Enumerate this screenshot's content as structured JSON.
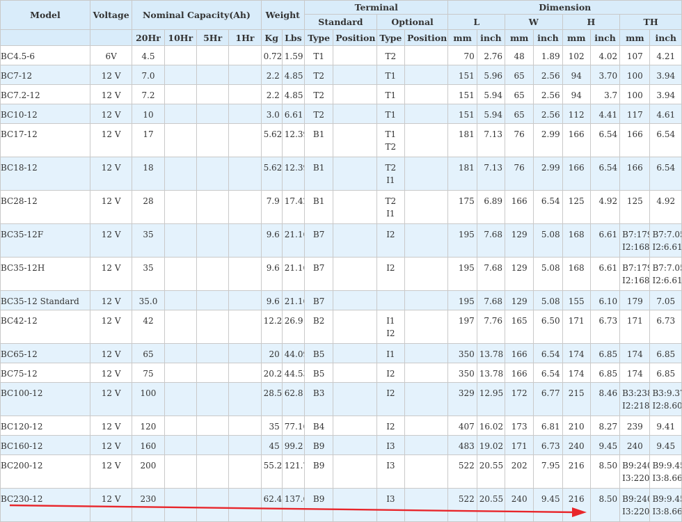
{
  "headers": {
    "model": "Model",
    "voltage": "Voltage",
    "nominal_capacity": "Nominal Capacity(Ah)",
    "weight": "Weight",
    "terminal": "Terminal",
    "dimension": "Dimension",
    "standard": "Standard",
    "optional": "Optional",
    "dim_L": "L",
    "dim_W": "W",
    "dim_H": "H",
    "dim_TH": "TH",
    "sub": {
      "hr20": "20Hr",
      "hr10": "10Hr",
      "hr5": "5Hr",
      "hr1": "1Hr",
      "kg": "Kg",
      "lbs": "Lbs",
      "std_type": "Type",
      "std_position": "Position",
      "opt_type": "Type",
      "opt_position": "Position",
      "l_mm": "mm",
      "l_inch": "inch",
      "w_mm": "mm",
      "w_inch": "inch",
      "h_mm": "mm",
      "h_inch": "inch",
      "th_mm": "mm",
      "th_inch": "inch"
    }
  },
  "rows": [
    {
      "model": "BC4.5-6",
      "voltage": "6V",
      "cap20": "4.5",
      "kg": "0.72",
      "lbs": "1.59",
      "std": "T1",
      "opt": [
        "T2"
      ],
      "l_mm": "70",
      "l_in": "2.76",
      "w_mm": "48",
      "w_in": "1.89",
      "h_mm": "102",
      "h_in": "4.02",
      "th_mm": "107",
      "th_in": "4.21"
    },
    {
      "model": "BC7-12",
      "voltage": "12 V",
      "cap20": "7.0",
      "kg": "2.2",
      "lbs": "4.85",
      "std": "T2",
      "opt": [
        "T1"
      ],
      "l_mm": "151",
      "l_in": "5.96",
      "w_mm": "65",
      "w_in": "2.56",
      "h_mm": "94",
      "h_in": "3.70",
      "th_mm": "100",
      "th_in": "3.94"
    },
    {
      "model": "BC7.2-12",
      "voltage": "12 V",
      "cap20": "7.2",
      "kg": "2.2",
      "lbs": "4.85",
      "std": "T2",
      "opt": [
        "T1"
      ],
      "l_mm": "151",
      "l_in": "5.94",
      "w_mm": "65",
      "w_in": "2.56",
      "h_mm": "94",
      "h_in": "3.7",
      "th_mm": "100",
      "th_in": "3.94"
    },
    {
      "model": "BC10-12",
      "voltage": "12 V",
      "cap20": "10",
      "kg": "3.0",
      "lbs": "6.61",
      "std": "T2",
      "opt": [
        "T1"
      ],
      "l_mm": "151",
      "l_in": "5.94",
      "w_mm": "65",
      "w_in": "2.56",
      "h_mm": "112",
      "h_in": "4.41",
      "th_mm": "117",
      "th_in": "4.61"
    },
    {
      "model": "BC17-12",
      "voltage": "12 V",
      "cap20": "17",
      "kg": "5.62",
      "lbs": "12.39",
      "std": "B1",
      "opt": [
        "T1",
        "T2"
      ],
      "l_mm": "181",
      "l_in": "7.13",
      "w_mm": "76",
      "w_in": "2.99",
      "h_mm": "166",
      "h_in": "6.54",
      "th_mm": "166",
      "th_in": "6.54"
    },
    {
      "model": "BC18-12",
      "voltage": "12 V",
      "cap20": "18",
      "kg": "5.62",
      "lbs": "12.39",
      "std": "B1",
      "opt": [
        "T2",
        "I1"
      ],
      "l_mm": "181",
      "l_in": "7.13",
      "w_mm": "76",
      "w_in": "2.99",
      "h_mm": "166",
      "h_in": "6.54",
      "th_mm": "166",
      "th_in": "6.54"
    },
    {
      "model": "BC28-12",
      "voltage": "12 V",
      "cap20": "28",
      "kg": "7.9",
      "lbs": "17.42",
      "std": "B1",
      "opt": [
        "T2",
        "I1"
      ],
      "l_mm": "175",
      "l_in": "6.89",
      "w_mm": "166",
      "w_in": "6.54",
      "h_mm": "125",
      "h_in": "4.92",
      "th_mm": "125",
      "th_in": "4.92"
    },
    {
      "model": "BC35-12F",
      "voltage": "12 V",
      "cap20": "35",
      "kg": "9.6",
      "lbs": "21.16",
      "std": "B7",
      "opt": [
        "I2"
      ],
      "l_mm": "195",
      "l_in": "7.68",
      "w_mm": "129",
      "w_in": "5.08",
      "h_mm": "168",
      "h_in": "6.61",
      "th_mm": "B7:179, I2:168",
      "th_in": "B7:7.05, I2:6.61"
    },
    {
      "model": "BC35-12H",
      "voltage": "12 V",
      "cap20": "35",
      "kg": "9.6",
      "lbs": "21.16",
      "std": "B7",
      "opt": [
        "I2"
      ],
      "l_mm": "195",
      "l_in": "7.68",
      "w_mm": "129",
      "w_in": "5.08",
      "h_mm": "168",
      "h_in": "6.61",
      "th_mm": "B7:179, I2:168",
      "th_in": "B7:7.05, I2:6.61"
    },
    {
      "model": "BC35-12 Standard",
      "voltage": "12 V",
      "cap20": "35.0",
      "kg": "9.6",
      "lbs": "21.16",
      "std": "B7",
      "opt": [],
      "l_mm": "195",
      "l_in": "7.68",
      "w_mm": "129",
      "w_in": "5.08",
      "h_mm": "155",
      "h_in": "6.10",
      "th_mm": "179",
      "th_in": "7.05"
    },
    {
      "model": "BC42-12",
      "voltage": "12 V",
      "cap20": "42",
      "kg": "12.2",
      "lbs": "26.9",
      "std": "B2",
      "opt": [
        "I1",
        "I2"
      ],
      "l_mm": "197",
      "l_in": "7.76",
      "w_mm": "165",
      "w_in": "6.50",
      "h_mm": "171",
      "h_in": "6.73",
      "th_mm": "171",
      "th_in": "6.73"
    },
    {
      "model": "BC65-12",
      "voltage": "12 V",
      "cap20": "65",
      "kg": "20",
      "lbs": "44.09",
      "std": "B5",
      "opt": [
        "I1"
      ],
      "l_mm": "350",
      "l_in": "13.78",
      "w_mm": "166",
      "w_in": "6.54",
      "h_mm": "174",
      "h_in": "6.85",
      "th_mm": "174",
      "th_in": "6.85"
    },
    {
      "model": "BC75-12",
      "voltage": "12 V",
      "cap20": "75",
      "kg": "20.2",
      "lbs": "44.53",
      "std": "B5",
      "opt": [
        "I2"
      ],
      "l_mm": "350",
      "l_in": "13.78",
      "w_mm": "166",
      "w_in": "6.54",
      "h_mm": "174",
      "h_in": "6.85",
      "th_mm": "174",
      "th_in": "6.85"
    },
    {
      "model": "BC100-12",
      "voltage": "12 V",
      "cap20": "100",
      "kg": "28.5",
      "lbs": "62.8",
      "std": "B3",
      "opt": [
        "I2"
      ],
      "l_mm": "329",
      "l_in": "12.95",
      "w_mm": "172",
      "w_in": "6.77",
      "h_mm": "215",
      "h_in": "8.46",
      "th_mm": "B3:238, I2:218",
      "th_in": "B3:9.37, I2:8.60"
    },
    {
      "model": "BC120-12",
      "voltage": "12 V",
      "cap20": "120",
      "kg": "35",
      "lbs": "77.16",
      "std": "B4",
      "opt": [
        "I2"
      ],
      "l_mm": "407",
      "l_in": "16.02",
      "w_mm": "173",
      "w_in": "6.81",
      "h_mm": "210",
      "h_in": "8.27",
      "th_mm": "239",
      "th_in": "9.41"
    },
    {
      "model": "BC160-12",
      "voltage": "12 V",
      "cap20": "160",
      "kg": "45",
      "lbs": "99.21",
      "std": "B9",
      "opt": [
        "I3"
      ],
      "l_mm": "483",
      "l_in": "19.02",
      "w_mm": "171",
      "w_in": "6.73",
      "h_mm": "240",
      "h_in": "9.45",
      "th_mm": "240",
      "th_in": "9.45"
    },
    {
      "model": "BC200-12",
      "voltage": "12 V",
      "cap20": "200",
      "kg": "55.2",
      "lbs": "121.7",
      "std": "B9",
      "opt": [
        "I3"
      ],
      "l_mm": "522",
      "l_in": "20.55",
      "w_mm": "202",
      "w_in": "7.95",
      "h_mm": "216",
      "h_in": "8.50",
      "th_mm": "B9:240, I3:220",
      "th_in": "B9:9.45, I3:8.66"
    },
    {
      "model": "BC230-12",
      "voltage": "12 V",
      "cap20": "230",
      "kg": "62.4",
      "lbs": "137.6",
      "std": "B9",
      "opt": [
        "I3"
      ],
      "l_mm": "522",
      "l_in": "20.55",
      "w_mm": "240",
      "w_in": "9.45",
      "h_mm": "216",
      "h_in": "8.50",
      "th_mm": "B9:240, I3:220",
      "th_in": "B9:9.45, I3:8.66"
    }
  ],
  "annotation": {
    "arrow_color": "#e8262b"
  },
  "colors": {
    "header_bg": "#d9ecfa",
    "row_alt_bg": "#e4f2fc",
    "border": "#c9c9c9"
  }
}
